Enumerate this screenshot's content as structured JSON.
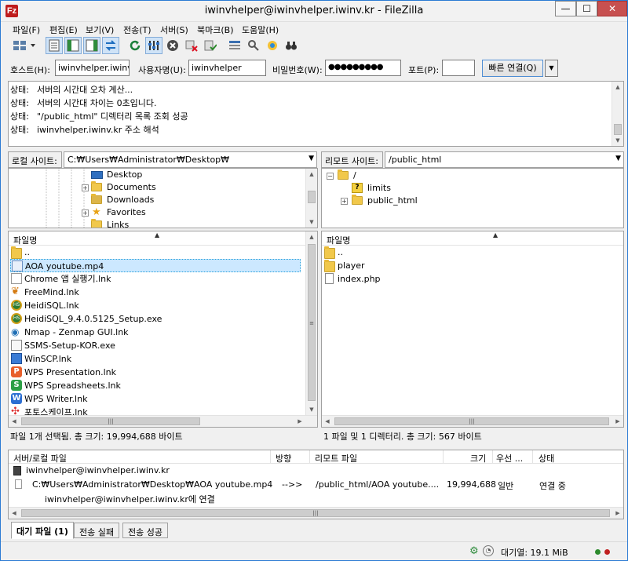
{
  "window": {
    "title": "iwinvhelper@iwinvhelper.iwinv.kr - FileZilla",
    "app_icon_letter": "Fz",
    "minimize": "—",
    "maximize": "☐",
    "close": "✕"
  },
  "menu": [
    "파일(F)",
    "편집(E)",
    "보기(V)",
    "전송(T)",
    "서버(S)",
    "북마크(B)",
    "도움말(H)"
  ],
  "quickconnect": {
    "host_label": "호스트(H):",
    "host_value": "iwinvhelper.iwinv.kr",
    "user_label": "사용자명(U):",
    "user_value": "iwinvhelper",
    "pass_label": "비밀번호(W):",
    "pass_value": "●●●●●●●●●",
    "port_label": "포트(P):",
    "port_value": "",
    "connect_button": "빠른 연결(Q)",
    "dropdown": "▼"
  },
  "log": [
    {
      "key": "상태:",
      "text": "서버의 시간대 오차 계산..."
    },
    {
      "key": "상태:",
      "text": "서버의 시간대 차이는 0초입니다."
    },
    {
      "key": "상태:",
      "text": "\"/public_html\" 디렉터리 목록 조회 성공"
    },
    {
      "key": "상태:",
      "text": "iwinvhelper.iwinv.kr 주소 해석"
    }
  ],
  "local": {
    "site_label": "로컬 사이트:",
    "path": "C:₩Users₩Administrator₩Desktop₩",
    "tree": [
      {
        "label": "Desktop",
        "expand": ""
      },
      {
        "label": "Documents",
        "expand": "+"
      },
      {
        "label": "Downloads",
        "expand": ""
      },
      {
        "label": "Favorites",
        "expand": "+"
      },
      {
        "label": "Links",
        "expand": ""
      }
    ],
    "column_filename": "파일명",
    "files": [
      {
        "name": "..",
        "icon": "folder"
      },
      {
        "name": "AOA youtube.mp4",
        "icon": "video",
        "selected": true
      },
      {
        "name": "Chrome 앱 실행기.lnk",
        "icon": "doc"
      },
      {
        "name": "FreeMind.lnk",
        "icon": "butterfly"
      },
      {
        "name": "HeidiSQL.lnk",
        "icon": "heidi"
      },
      {
        "name": "HeidiSQL_9.4.0.5125_Setup.exe",
        "icon": "heidi"
      },
      {
        "name": "Nmap - Zenmap GUI.lnk",
        "icon": "nmap"
      },
      {
        "name": "SSMS-Setup-KOR.exe",
        "icon": "ssms"
      },
      {
        "name": "WinSCP.lnk",
        "icon": "winscp"
      },
      {
        "name": "WPS Presentation.lnk",
        "icon": "wpsp"
      },
      {
        "name": "WPS Spreadsheets.lnk",
        "icon": "wpss"
      },
      {
        "name": "WPS Writer.lnk",
        "icon": "wpsw"
      },
      {
        "name": "포토스케이프.lnk",
        "icon": "photoscape"
      }
    ],
    "status": "파일 1개 선택됨. 총 크기: 19,994,688 바이트"
  },
  "remote": {
    "site_label": "리모트 사이트:",
    "path": "/public_html",
    "tree": [
      {
        "label": "/",
        "expand": "−",
        "icon": "folder"
      },
      {
        "label": "limits",
        "expand": "",
        "icon": "question"
      },
      {
        "label": "public_html",
        "expand": "+",
        "icon": "folder"
      }
    ],
    "column_filename": "파일명",
    "files": [
      {
        "name": "..",
        "icon": "folder"
      },
      {
        "name": "player",
        "icon": "folder"
      },
      {
        "name": "index.php",
        "icon": "file"
      }
    ],
    "status": "1 파일 및 1 디렉터리. 총 크기: 567 바이트"
  },
  "queue": {
    "columns": [
      "서버/로컬 파일",
      "방향",
      "리모트 파일",
      "크기",
      "우선 ...",
      "상태"
    ],
    "server": "iwinvhelper@iwinvhelper.iwinv.kr",
    "local_file": "C:₩Users₩Administrator₩Desktop₩AOA youtube.mp4",
    "direction": "-->>",
    "remote_file": "/public_html/AOA youtube....",
    "size": "19,994,688",
    "priority": "일반",
    "state": "연결 중",
    "substatus": "iwinvhelper@iwinvhelper.iwinv.kr에 연결"
  },
  "tabs": [
    "대기 파일 (1)",
    "전송 실패",
    "전송 성공"
  ],
  "statusbar": {
    "queue_label": "대기열: 19.1 MiB"
  },
  "colors": {
    "selection": "#cce8ff",
    "led_green": "#2d8a2d",
    "led_red": "#c02020",
    "window_border": "#2b7bd3"
  }
}
